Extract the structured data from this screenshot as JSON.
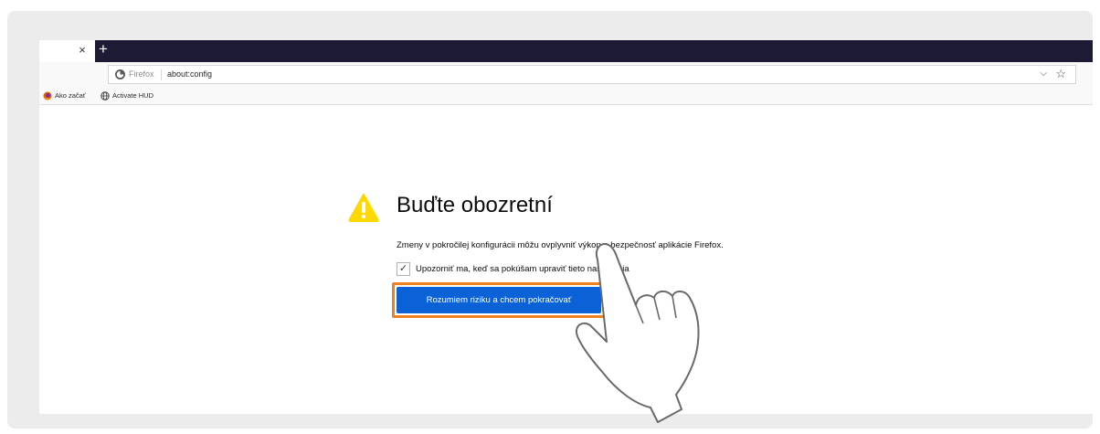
{
  "browser": {
    "tab_close_glyph": "×",
    "new_tab_glyph": "+",
    "identity_label": "Firefox",
    "url": "about:config",
    "url_dropdown_glyph": "⌵",
    "bookmark_star_glyph": "☆"
  },
  "bookmarks": [
    {
      "label": "Ako začať",
      "icon": "firefox-icon"
    },
    {
      "label": "Activate HUD",
      "icon": "globe-icon"
    }
  ],
  "warning_page": {
    "heading": "Buďte obozretní",
    "description": "Zmeny v pokročilej konfigurácii môžu ovplyvniť výkon a bezpečnosť aplikácie Firefox.",
    "checkbox_checked": true,
    "checkbox_glyph": "✓",
    "checkbox_label": "Upozorniť ma, keď sa pokúšam upraviť tieto nastavenia",
    "accept_button_label": "Rozumiem riziku a chcem pokračovať"
  },
  "colors": {
    "tabstrip_dark": "#1c1b33",
    "button_blue": "#0a62d6",
    "highlight_orange": "#f0811f",
    "warning_yellow": "#ffd800"
  }
}
